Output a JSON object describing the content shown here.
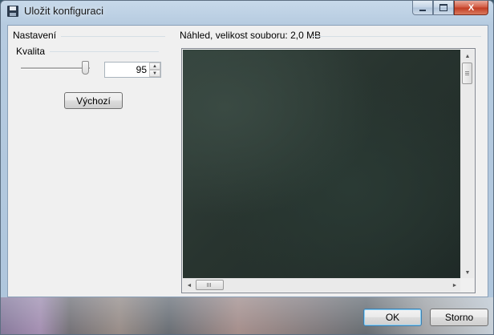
{
  "window": {
    "title": "Uložit konfiguraci",
    "icon": "floppy-disk-icon",
    "controls": {
      "minimize": "minimize-icon",
      "maximize": "maximize-icon",
      "close": "close-icon",
      "close_glyph": "X"
    }
  },
  "settings": {
    "group_label": "Nastavení",
    "quality": {
      "label": "Kvalita",
      "value": "95",
      "spin_up": "▲",
      "spin_down": "▼"
    },
    "default_button": "Výchozí"
  },
  "preview": {
    "label": "Náhled, velikost souboru: 2,0 MB",
    "scroll_up": "▲",
    "scroll_down": "▼",
    "scroll_left": "◄",
    "scroll_right": "►"
  },
  "footer": {
    "ok_label": "OK",
    "cancel_label": "Storno"
  },
  "colors": {
    "titlebar": "#b6cbe0",
    "client": "#f0f0f0",
    "preview_image": "#28342f",
    "close_button": "#c13b22",
    "default_button_border": "#3c7fb1"
  }
}
